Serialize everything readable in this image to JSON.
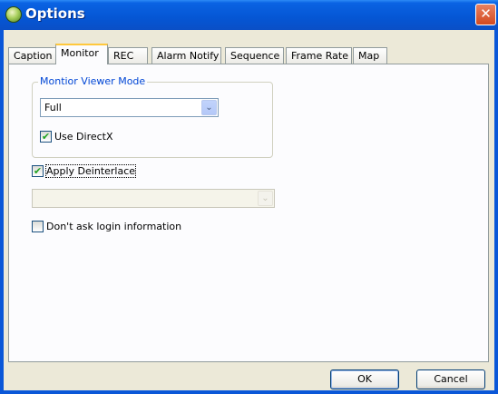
{
  "window": {
    "title": "Options",
    "close_glyph": "✕",
    "icon": "app-logo-icon"
  },
  "tabs": [
    {
      "label": "Caption",
      "active": false
    },
    {
      "label": "Monitor",
      "active": true
    },
    {
      "label": "REC",
      "active": false
    },
    {
      "label": "Alarm Notify",
      "active": false
    },
    {
      "label": "Sequence",
      "active": false
    },
    {
      "label": "Frame Rate",
      "active": false
    },
    {
      "label": "Map",
      "active": false
    }
  ],
  "monitor": {
    "group_label": "Montior Viewer Mode",
    "viewer_mode": {
      "value": "Full",
      "arrow_glyph": "⌄"
    },
    "use_directx": {
      "label": "Use DirectX",
      "checked": true
    },
    "apply_deinterlace": {
      "label": "Apply Deinterlace",
      "checked": true
    },
    "deinterlace_combo": {
      "value": "",
      "enabled": false,
      "arrow_glyph": "⌄"
    },
    "dont_ask_login": {
      "label": "Don't ask login information",
      "checked": false
    }
  },
  "buttons": {
    "ok": "OK",
    "cancel": "Cancel"
  },
  "colors": {
    "titlebar": "#0556d4",
    "groupbox_label": "#0046d5",
    "active_tab_accent": "#ffc83c",
    "face": "#ece9d8"
  }
}
